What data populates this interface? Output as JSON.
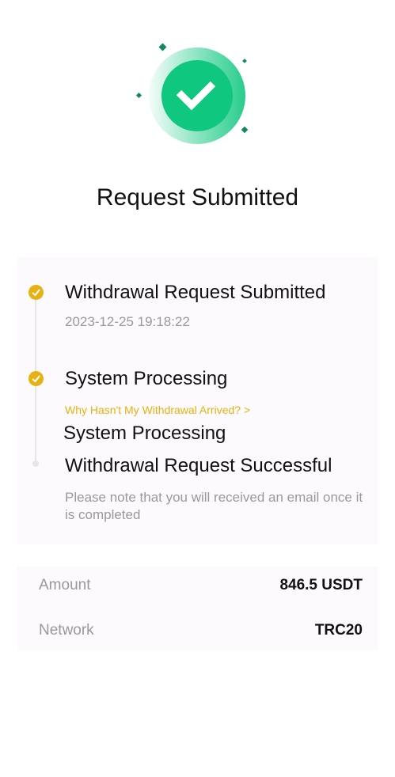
{
  "header": {
    "title": "Request Submitted",
    "status_icon": "success-check-icon",
    "accent": "#10c77f"
  },
  "timeline": {
    "steps": [
      {
        "title": "Withdrawal Request Submitted",
        "time": "2023-12-25 19:18:22",
        "done": true
      },
      {
        "title": "System Processing",
        "link": "Why Hasn't My Withdrawal Arrived? >",
        "extra": "System Processing",
        "done": true
      },
      {
        "title": "Withdrawal Request Successful",
        "note": "Please note that you will received an email once it is completed",
        "done": false
      }
    ],
    "done_color": "#e8b112"
  },
  "details": {
    "rows": [
      {
        "label": "Amount",
        "value": "846.5 USDT"
      },
      {
        "label": "Network",
        "value": "TRC20"
      }
    ]
  }
}
